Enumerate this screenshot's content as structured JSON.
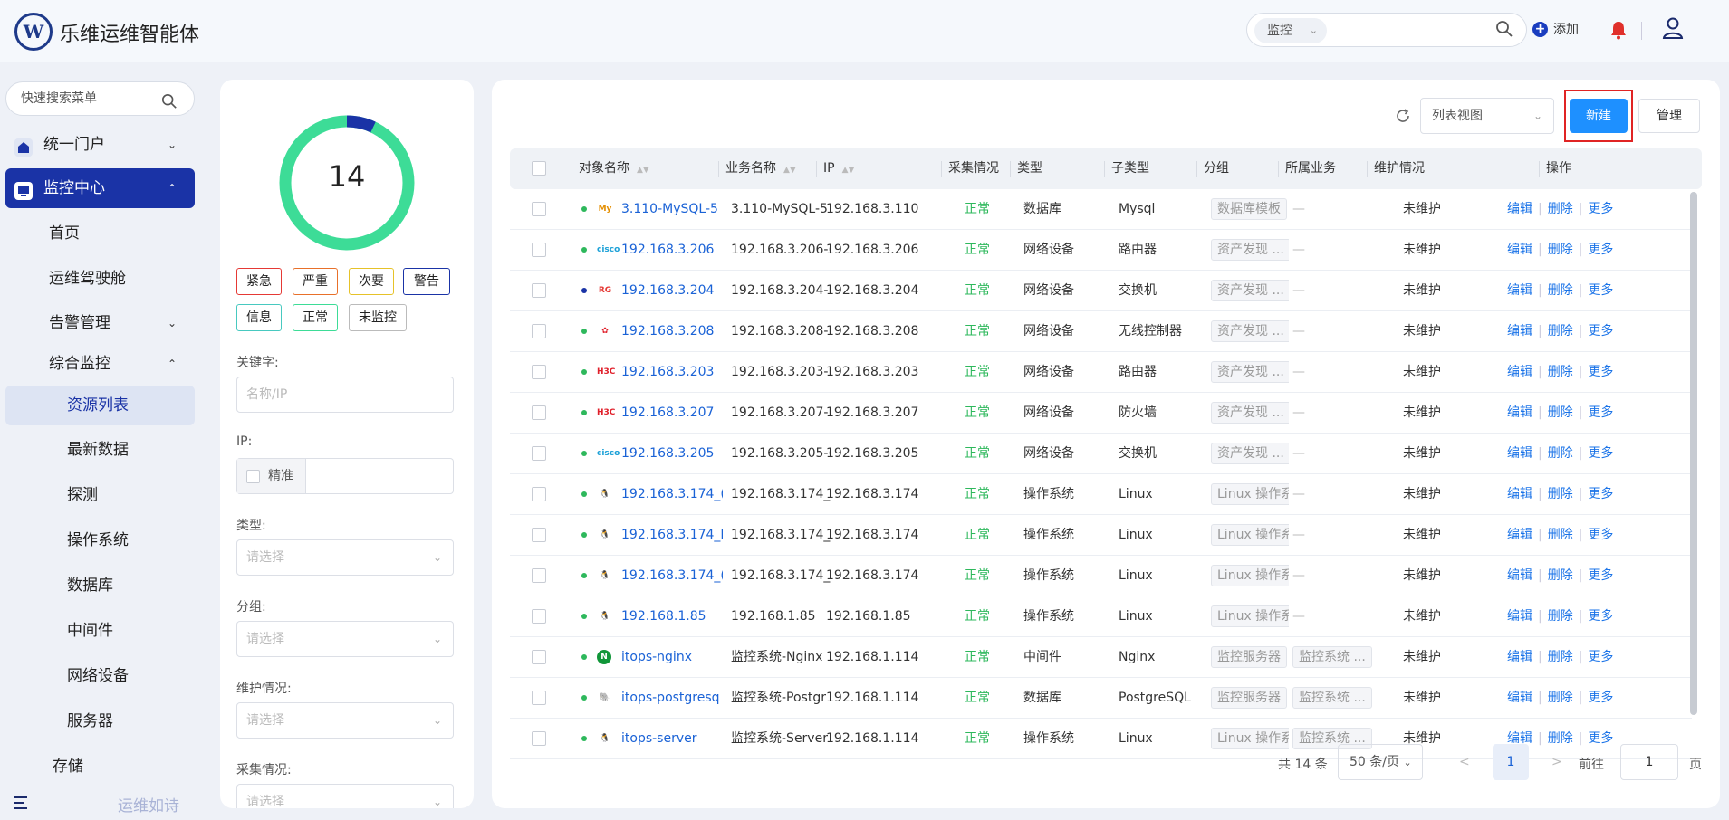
{
  "header": {
    "app_title": "乐维运维智能体",
    "logo_letter": "W",
    "search_scope": "监控",
    "add_label": "添加",
    "icons": [
      "search-icon",
      "plus-icon",
      "bell-icon",
      "user-icon"
    ]
  },
  "sidebar": {
    "search_placeholder": "快速搜索菜单",
    "items": [
      {
        "label": "统一门户"
      },
      {
        "label": "监控中心"
      },
      {
        "label": "首页"
      },
      {
        "label": "运维驾驶舱"
      },
      {
        "label": "告警管理"
      },
      {
        "label": "综合监控"
      },
      {
        "label": "资源列表"
      },
      {
        "label": "最新数据"
      },
      {
        "label": "探测"
      },
      {
        "label": "操作系统"
      },
      {
        "label": "数据库"
      },
      {
        "label": "中间件"
      },
      {
        "label": "网络设备"
      },
      {
        "label": "服务器"
      },
      {
        "label": "存储"
      }
    ],
    "footer": "运维如诗"
  },
  "filter": {
    "total": "14",
    "severity_tags": [
      "紧急",
      "严重",
      "次要",
      "警告",
      "信息",
      "正常",
      "未监控"
    ],
    "keyword_label": "关键字:",
    "keyword_placeholder": "名称/IP",
    "ip_label": "IP:",
    "exact_label": "精准",
    "type_label": "类型:",
    "type_placeholder": "请选择",
    "group_label": "分组:",
    "group_placeholder": "请选择",
    "maint_label": "维护情况:",
    "maint_placeholder": "请选择",
    "collect_label": "采集情况:",
    "collect_placeholder": "请选择"
  },
  "toolbar": {
    "view_label": "列表视图",
    "new_label": "新建",
    "manage_label": "管理"
  },
  "table": {
    "headers": [
      "对象名称",
      "业务名称",
      "IP",
      "采集情况",
      "类型",
      "子类型",
      "分组",
      "所属业务",
      "维护情况",
      "操作"
    ],
    "op_edit": "编辑",
    "op_delete": "删除",
    "op_more": "更多",
    "rows": [
      {
        "name": "3.110-MySQL-5",
        "biz": "3.110-MySQL-5",
        "ip": "192.168.3.110",
        "status": "正常",
        "type": "数据库",
        "subtype": "Mysql",
        "group": "数据库模板",
        "service": "—",
        "maint": "未维护",
        "icon": "mysql-icon",
        "dot": "#2eb85c"
      },
      {
        "name": "192.168.3.206",
        "biz": "192.168.3.206-(",
        "ip": "192.168.3.206",
        "status": "正常",
        "type": "网络设备",
        "subtype": "路由器",
        "group": "资产发现 ...",
        "service": "—",
        "maint": "未维护",
        "icon": "cisco-icon",
        "dot": "#2eb85c"
      },
      {
        "name": "192.168.3.204",
        "biz": "192.168.3.204-I",
        "ip": "192.168.3.204",
        "status": "正常",
        "type": "网络设备",
        "subtype": "交换机",
        "group": "资产发现 ...",
        "service": "—",
        "maint": "未维护",
        "icon": "ruijie-icon",
        "dot": "#1a33a6"
      },
      {
        "name": "192.168.3.208",
        "biz": "192.168.3.208-I",
        "ip": "192.168.3.208",
        "status": "正常",
        "type": "网络设备",
        "subtype": "无线控制器",
        "group": "资产发现 ...",
        "service": "—",
        "maint": "未维护",
        "icon": "huawei-icon",
        "dot": "#2eb85c"
      },
      {
        "name": "192.168.3.203",
        "biz": "192.168.3.203-I",
        "ip": "192.168.3.203",
        "status": "正常",
        "type": "网络设备",
        "subtype": "路由器",
        "group": "资产发现 ...",
        "service": "—",
        "maint": "未维护",
        "icon": "h3c-icon",
        "dot": "#2eb85c"
      },
      {
        "name": "192.168.3.207",
        "biz": "192.168.3.207-I",
        "ip": "192.168.3.207",
        "status": "正常",
        "type": "网络设备",
        "subtype": "防火墙",
        "group": "资产发现 ...",
        "service": "—",
        "maint": "未维护",
        "icon": "h3c-icon",
        "dot": "#2eb85c"
      },
      {
        "name": "192.168.3.205",
        "biz": "192.168.3.205-(",
        "ip": "192.168.3.205",
        "status": "正常",
        "type": "网络设备",
        "subtype": "交换机",
        "group": "资产发现 ...",
        "service": "—",
        "maint": "未维护",
        "icon": "cisco-icon",
        "dot": "#2eb85c"
      },
      {
        "name": "192.168.3.174_(",
        "biz": "192.168.3.174_(",
        "ip": "192.168.3.174",
        "status": "正常",
        "type": "操作系统",
        "subtype": "Linux",
        "group": "Linux 操作系",
        "service": "—",
        "maint": "未维护",
        "icon": "linux-icon",
        "dot": "#2eb85c"
      },
      {
        "name": "192.168.3.174_I",
        "biz": "192.168.3.174_I",
        "ip": "192.168.3.174",
        "status": "正常",
        "type": "操作系统",
        "subtype": "Linux",
        "group": "Linux 操作系",
        "service": "—",
        "maint": "未维护",
        "icon": "linux-icon",
        "dot": "#2eb85c"
      },
      {
        "name": "192.168.3.174_(",
        "biz": "192.168.3.174_(",
        "ip": "192.168.3.174",
        "status": "正常",
        "type": "操作系统",
        "subtype": "Linux",
        "group": "Linux 操作系",
        "service": "—",
        "maint": "未维护",
        "icon": "linux-icon",
        "dot": "#2eb85c"
      },
      {
        "name": "192.168.1.85",
        "biz": "192.168.1.85",
        "ip": "192.168.1.85",
        "status": "正常",
        "type": "操作系统",
        "subtype": "Linux",
        "group": "Linux 操作系",
        "service": "—",
        "maint": "未维护",
        "icon": "linux-icon",
        "dot": "#2eb85c"
      },
      {
        "name": "itops-nginx",
        "biz": "监控系统-Nginx",
        "ip": "192.168.1.114",
        "status": "正常",
        "type": "中间件",
        "subtype": "Nginx",
        "group": "监控服务器",
        "service": "监控系统 ...",
        "maint": "未维护",
        "icon": "nginx-icon",
        "dot": "#2eb85c"
      },
      {
        "name": "itops-postgresq",
        "biz": "监控系统-Postgr",
        "ip": "192.168.1.114",
        "status": "正常",
        "type": "数据库",
        "subtype": "PostgreSQL",
        "group": "监控服务器",
        "service": "监控系统 ...",
        "maint": "未维护",
        "icon": "postgres-icon",
        "dot": "#2eb85c"
      },
      {
        "name": "itops-server",
        "biz": "监控系统-Server",
        "ip": "192.168.1.114",
        "status": "正常",
        "type": "操作系统",
        "subtype": "Linux",
        "group": "Linux 操作系",
        "service": "监控系统 ...",
        "maint": "未维护",
        "icon": "linux-icon",
        "dot": "#2eb85c"
      }
    ]
  },
  "pagination": {
    "total": "共 14 条",
    "page_size": "50 条/页",
    "current": "1",
    "goto_label": "前往",
    "goto_value": "1",
    "page_unit": "页"
  },
  "colors": {
    "primary": "#1a33a6",
    "accent": "#1e90ff",
    "ok": "#2eb85c",
    "ring": "#3ddc97",
    "highlight": "#e02424"
  }
}
